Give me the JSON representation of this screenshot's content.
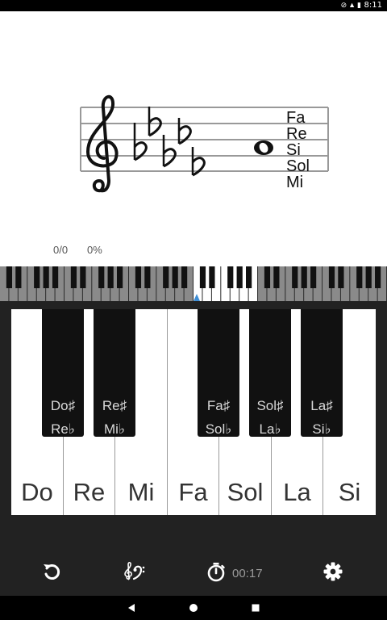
{
  "status_bar": {
    "time": "8:11",
    "icons": [
      "wifi-off-icon",
      "signal-icon",
      "battery-icon"
    ]
  },
  "staff": {
    "clef": "treble-clef",
    "key_signature": "flats",
    "flat_count": 5,
    "note_names": [
      "Fa",
      "Re",
      "Si",
      "Sol",
      "Mi"
    ]
  },
  "score": {
    "count": "0/0",
    "percent": "0%"
  },
  "keyboard": {
    "white_keys": [
      "Do",
      "Re",
      "Mi",
      "Fa",
      "Sol",
      "La",
      "Si"
    ],
    "black_keys": [
      {
        "sharp": "Do♯",
        "flat": "Re♭"
      },
      {
        "sharp": "Re♯",
        "flat": "Mi♭"
      },
      {
        "sharp": "Fa♯",
        "flat": "Sol♭"
      },
      {
        "sharp": "Sol♯",
        "flat": "La♭"
      },
      {
        "sharp": "La♯",
        "flat": "Si♭"
      }
    ]
  },
  "toolbar": {
    "timer": "00:17",
    "icons": [
      "reset-icon",
      "clef-toggle-icon",
      "stopwatch-icon",
      "settings-icon"
    ]
  },
  "colors": {
    "key_background": "#222222",
    "marker": "#3f8fd6",
    "label_gray": "#9a9a9a"
  }
}
